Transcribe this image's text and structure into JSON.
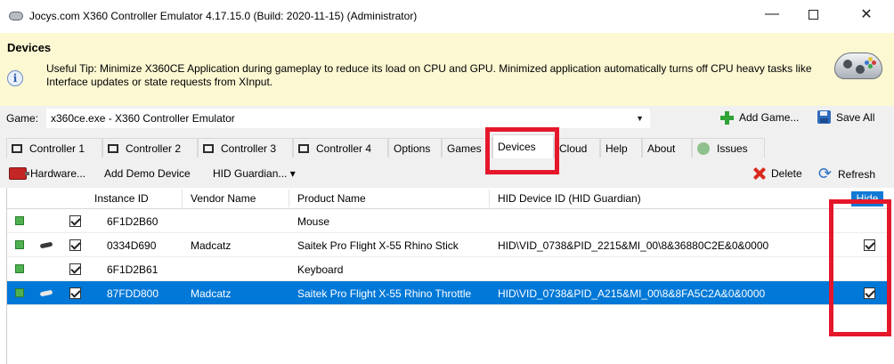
{
  "window": {
    "title": "Jocys.com X360 Controller Emulator 4.17.15.0 (Build: 2020-11-15) (Administrator)",
    "minimize": "—",
    "close": "✕"
  },
  "info": {
    "title": "Devices",
    "icon": "i",
    "tip": "Useful Tip: Minimize X360CE Application during gameplay to reduce its load on CPU and GPU. Minimized application automatically turns off CPU heavy tasks like Interface updates or state requests from XInput."
  },
  "game": {
    "label": "Game:",
    "selected": "x360ce.exe - X360 Controller Emulator",
    "add_game": "Add Game...",
    "save_all": "Save All"
  },
  "tabs": [
    {
      "label": "Controller 1"
    },
    {
      "label": "Controller 2"
    },
    {
      "label": "Controller 3"
    },
    {
      "label": "Controller 4"
    },
    {
      "label": "Options"
    },
    {
      "label": "Games"
    },
    {
      "label": "Devices"
    },
    {
      "label": "Cloud"
    },
    {
      "label": "Help"
    },
    {
      "label": "About"
    },
    {
      "label": "Issues"
    }
  ],
  "toolbar": {
    "hardware": "Hardware...",
    "add_demo": "Add Demo Device",
    "hid_guardian": "HID Guardian... ▾",
    "delete": "Delete",
    "refresh": "Refresh"
  },
  "grid": {
    "columns": {
      "instance": "Instance ID",
      "vendor": "Vendor Name",
      "product": "Product Name",
      "hid": "HID Device ID (HID Guardian)",
      "hide": "Hide"
    },
    "rows": [
      {
        "instance": "6F1D2B60",
        "vendor": "",
        "product": "Mouse",
        "hid": ""
      },
      {
        "instance": "0334D690",
        "vendor": "Madcatz",
        "product": "Saitek Pro Flight X-55 Rhino Stick",
        "hid": "HID\\VID_0738&PID_2215&MI_00\\8&36880C2E&0&0000"
      },
      {
        "instance": "6F1D2B61",
        "vendor": "",
        "product": "Keyboard",
        "hid": ""
      },
      {
        "instance": "87FDD800",
        "vendor": "Madcatz",
        "product": "Saitek Pro Flight X-55 Rhino Throttle",
        "hid": "HID\\VID_0738&PID_A215&MI_00\\8&8FA5C2A&0&0000"
      }
    ]
  },
  "colors": {
    "selection": "#0078d7",
    "highlight": "#e5172b",
    "info_background": "#fbf8d2"
  }
}
